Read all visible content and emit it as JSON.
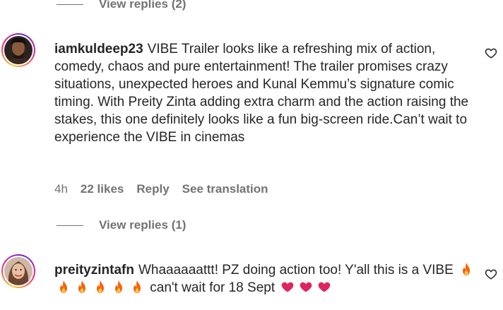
{
  "top_replies": {
    "label": "View replies (2)"
  },
  "comment1": {
    "username": "iamkuldeep23",
    "text": "VIBE Trailer looks like a refreshing mix of action, comedy, chaos and pure entertainment! The trailer promises crazy situations, unexpected heroes and Kunal Kemmu’s signature comic timing. With Preity Zinta adding extra charm and the action raising the stakes, this one definitely looks like a fun big-screen ride.Can’t wait to experience the VIBE in cinemas",
    "time": "4h",
    "likes": "22 likes",
    "reply": "Reply",
    "translate": "See translation",
    "replies": "View replies (1)"
  },
  "comment2": {
    "username": "preityzintafn",
    "text_part1": "Whaaaaaattt! PZ doing action too! Y'all this is a VIBE",
    "text_part2": "can't wait for 18 Sept",
    "emojis": [
      "fire",
      "fire",
      "fire",
      "fire",
      "fire",
      "fire"
    ],
    "hearts": [
      "heart",
      "heart",
      "heart"
    ]
  },
  "colors": {
    "text": "#262626",
    "muted": "#737373",
    "fire": "#f7630c",
    "heart": "#e0245e"
  },
  "icons": {
    "like": "heart-outline-icon"
  }
}
